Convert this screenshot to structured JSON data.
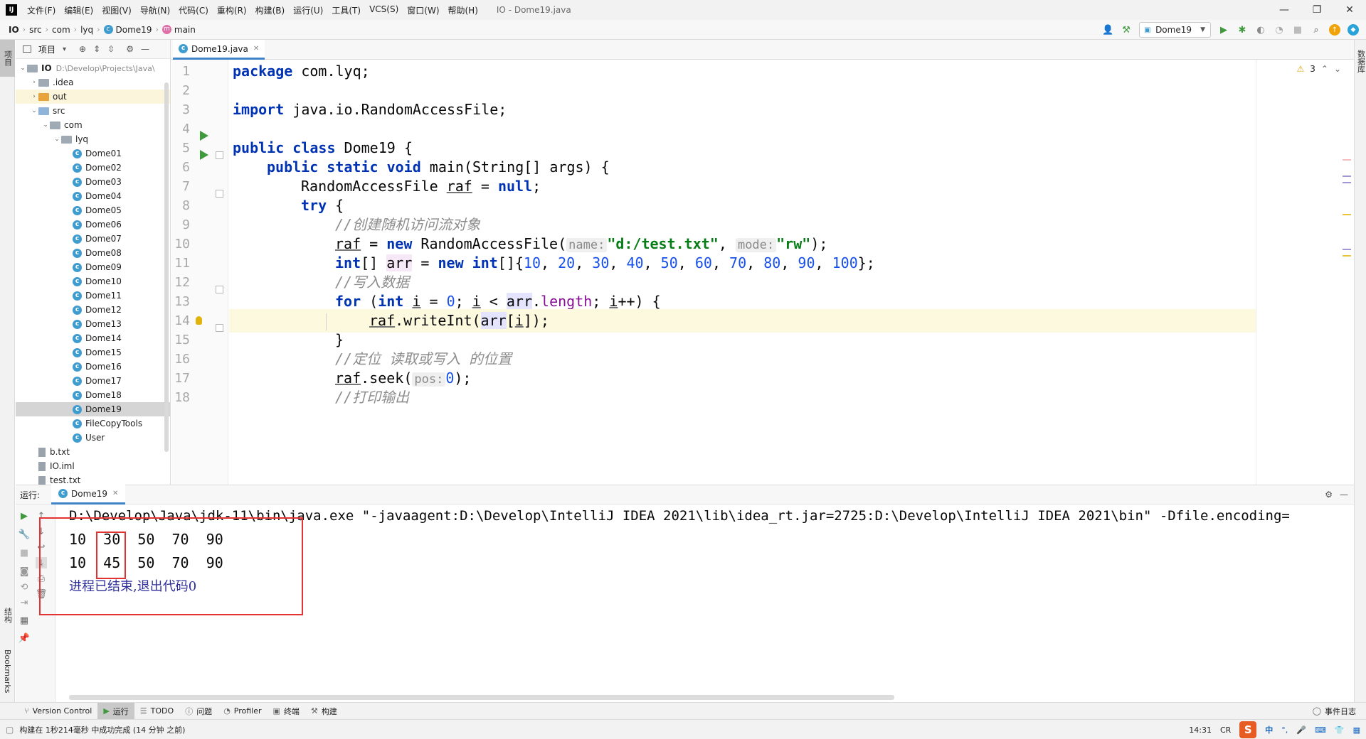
{
  "app": {
    "logo": "IJ",
    "window_title": "IO - Dome19.java"
  },
  "menu": [
    "文件(F)",
    "编辑(E)",
    "视图(V)",
    "导航(N)",
    "代码(C)",
    "重构(R)",
    "构建(B)",
    "运行(U)",
    "工具(T)",
    "VCS(S)",
    "窗口(W)",
    "帮助(H)"
  ],
  "window_controls": [
    "—",
    "❐",
    "✕"
  ],
  "breadcrumb": [
    "IO",
    "src",
    "com",
    "lyq",
    "Dome19",
    "main"
  ],
  "run_config": "Dome19",
  "left_strip": {
    "project_tab": "项目",
    "structure_tab": "结构",
    "bookmarks_tab": "Bookmarks"
  },
  "right_strip": {
    "database_tab": "数据库"
  },
  "project_panel": {
    "title": "项目",
    "tree": [
      {
        "label": "IO",
        "path": "D:\\Develop\\Projects\\Java\\",
        "level": 0,
        "type": "module",
        "arrow": "⌄"
      },
      {
        "label": ".idea",
        "level": 1,
        "type": "folder",
        "arrow": "›"
      },
      {
        "label": "out",
        "level": 1,
        "type": "folder-orange",
        "arrow": "›"
      },
      {
        "label": "src",
        "level": 1,
        "type": "folder-blue",
        "arrow": "⌄"
      },
      {
        "label": "com",
        "level": 2,
        "type": "folder",
        "arrow": "⌄"
      },
      {
        "label": "lyq",
        "level": 3,
        "type": "folder",
        "arrow": "⌄"
      },
      {
        "label": "Dome01",
        "level": 4,
        "type": "class"
      },
      {
        "label": "Dome02",
        "level": 4,
        "type": "class"
      },
      {
        "label": "Dome03",
        "level": 4,
        "type": "class"
      },
      {
        "label": "Dome04",
        "level": 4,
        "type": "class"
      },
      {
        "label": "Dome05",
        "level": 4,
        "type": "class"
      },
      {
        "label": "Dome06",
        "level": 4,
        "type": "class"
      },
      {
        "label": "Dome07",
        "level": 4,
        "type": "class"
      },
      {
        "label": "Dome08",
        "level": 4,
        "type": "class"
      },
      {
        "label": "Dome09",
        "level": 4,
        "type": "class"
      },
      {
        "label": "Dome10",
        "level": 4,
        "type": "class"
      },
      {
        "label": "Dome11",
        "level": 4,
        "type": "class"
      },
      {
        "label": "Dome12",
        "level": 4,
        "type": "class"
      },
      {
        "label": "Dome13",
        "level": 4,
        "type": "class"
      },
      {
        "label": "Dome14",
        "level": 4,
        "type": "class"
      },
      {
        "label": "Dome15",
        "level": 4,
        "type": "class"
      },
      {
        "label": "Dome16",
        "level": 4,
        "type": "class"
      },
      {
        "label": "Dome17",
        "level": 4,
        "type": "class"
      },
      {
        "label": "Dome18",
        "level": 4,
        "type": "class"
      },
      {
        "label": "Dome19",
        "level": 4,
        "type": "class",
        "selected": true
      },
      {
        "label": "FileCopyTools",
        "level": 4,
        "type": "class"
      },
      {
        "label": "User",
        "level": 4,
        "type": "class"
      },
      {
        "label": "b.txt",
        "level": 1,
        "type": "file"
      },
      {
        "label": "IO.iml",
        "level": 1,
        "type": "file"
      },
      {
        "label": "test.txt",
        "level": 1,
        "type": "file"
      }
    ]
  },
  "editor": {
    "tab": "Dome19.java",
    "problems_count": "3",
    "line_numbers": [
      "1",
      "2",
      "3",
      "4",
      "5",
      "6",
      "7",
      "8",
      "9",
      "10",
      "11",
      "12",
      "13",
      "14",
      "15",
      "16",
      "17",
      "18"
    ],
    "code": {
      "l1_kw": "package",
      "l1_rest": " com.lyq;",
      "l3_kw": "import",
      "l3_rest": " java.io.RandomAccessFile;",
      "l5_kw": "public class",
      "l5_rest": " Dome19 {",
      "l6_kw": "public static void",
      "l6_rest": " main(String[] args) {",
      "l7_a": "RandomAccessFile ",
      "l7_var": "raf",
      "l7_b": " = ",
      "l7_kw": "null",
      "l7_c": ";",
      "l8_kw": "try",
      "l8_rest": " {",
      "l9_cmt": "//创建随机访问流对象",
      "l10_var": "raf",
      "l10_a": " = ",
      "l10_kw": "new",
      "l10_b": " RandomAccessFile(",
      "l10_hint1": "name:",
      "l10_str1": "\"d:/test.txt\"",
      "l10_c": ", ",
      "l10_hint2": "mode:",
      "l10_str2": "\"rw\"",
      "l10_d": ");",
      "l11_kw1": "int",
      "l11_a": "[] ",
      "l11_var": "arr",
      "l11_b": " = ",
      "l11_kw2": "new",
      "l11_c": " ",
      "l11_kw3": "int",
      "l11_d": "[]{",
      "l11_nums": [
        "10",
        "20",
        "30",
        "40",
        "50",
        "60",
        "70",
        "80",
        "90",
        "100"
      ],
      "l11_e": "};",
      "l12_cmt": "//写入数据",
      "l13_kw1": "for",
      "l13_a": " (",
      "l13_kw2": "int",
      "l13_b": " ",
      "l13_i1": "i",
      "l13_c": " = ",
      "l13_n0": "0",
      "l13_d": "; ",
      "l13_i2": "i",
      "l13_e": " < ",
      "l13_arr": "arr",
      "l13_f": ".",
      "l13_len": "length",
      "l13_g": "; ",
      "l13_i3": "i",
      "l13_h": "++) {",
      "l14_var": "raf",
      "l14_a": ".writeInt(",
      "l14_arr": "arr",
      "l14_b": "[",
      "l14_i": "i",
      "l14_c": "]);",
      "l15": "}",
      "l16_cmt": "//定位 读取或写入 的位置",
      "l17_var": "raf",
      "l17_a": ".seek(",
      "l17_hint": "pos:",
      "l17_num": "0",
      "l17_b": ");",
      "l18_cmt": "//打印输出"
    }
  },
  "run_panel": {
    "label": "运行:",
    "tab": "Dome19",
    "command": "D:\\Develop\\Java\\jdk-11\\bin\\java.exe \"-javaagent:D:\\Develop\\IntelliJ IDEA 2021\\lib\\idea_rt.jar=2725:D:\\Develop\\IntelliJ IDEA 2021\\bin\" -Dfile.encoding=",
    "output_line1": "10  30  50  70  90",
    "output_line2": "10  45  50  70  90",
    "exit_message": "进程已结束,退出代码0"
  },
  "tool_windows": [
    "Version Control",
    "运行",
    "TODO",
    "问题",
    "Profiler",
    "终端",
    "构建"
  ],
  "event_log": "事件日志",
  "status": {
    "message": "构建在 1秒214毫秒 中成功完成 (14 分钟 之前)",
    "time": "14:31",
    "line_sep": "CR",
    "ime_logo": "S",
    "ime_lang": "中"
  }
}
